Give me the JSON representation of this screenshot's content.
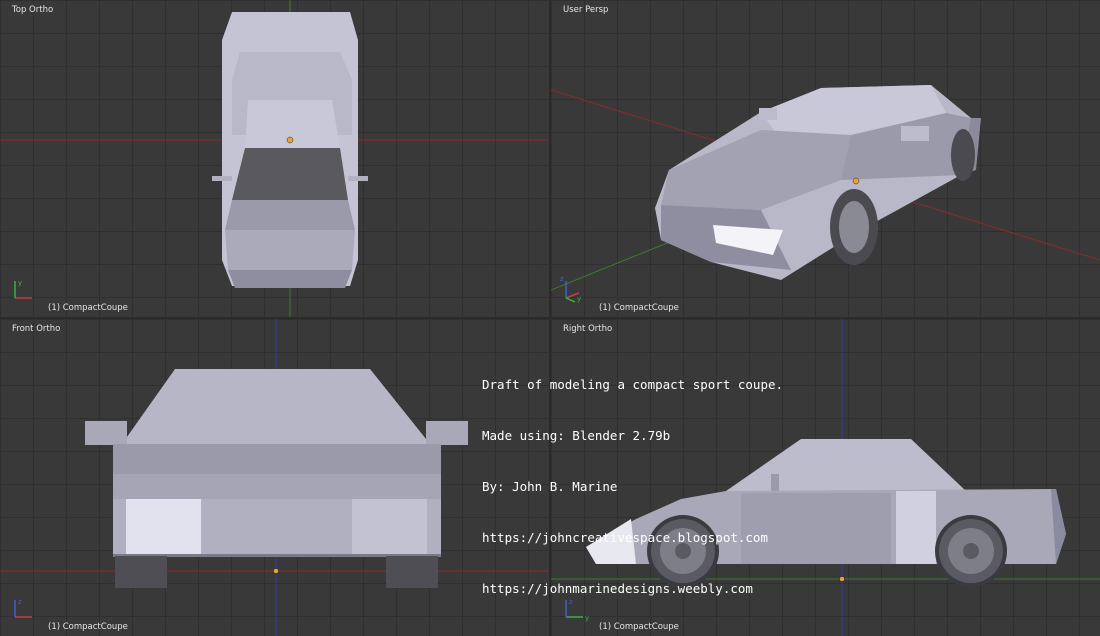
{
  "viewports": {
    "top": {
      "label": "Top Ortho",
      "object": "(1) CompactCoupe"
    },
    "persp": {
      "label": "User Persp",
      "object": "(1) CompactCoupe"
    },
    "front": {
      "label": "Front Ortho",
      "object": "(1) CompactCoupe"
    },
    "right": {
      "label": "Right Ortho",
      "object": "(1) CompactCoupe"
    }
  },
  "axis_labels": {
    "x": "x",
    "y": "y",
    "z": "z"
  },
  "overlay": {
    "line1": "Draft of modeling a compact sport coupe.",
    "line2": "Made using: Blender 2.79b",
    "line3": "By: John B. Marine",
    "line4": "https://johncreativespace.blogspot.com",
    "line5": "https://johnmarinedesigns.weebly.com"
  },
  "colors": {
    "viewport_bg": "#393939",
    "grid_line": "#2f2f2f",
    "axis_x": "#9a2a2a",
    "axis_y": "#3d8a2e",
    "axis_z": "#3636a8",
    "model_light": "#d6d6e6",
    "model_mid": "#b2b2c2",
    "model_dark": "#808090",
    "origin_dot": "#e8a33a",
    "text": "#e6e6e6"
  }
}
